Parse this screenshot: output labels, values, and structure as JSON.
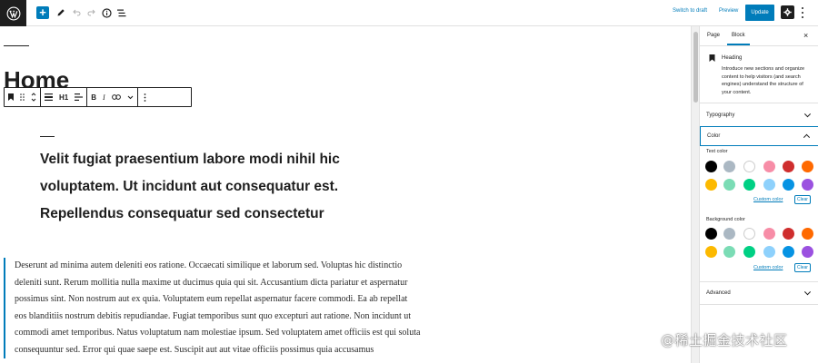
{
  "top_toolbar": {
    "switch_to_draft": "Switch to draft",
    "preview": "Preview",
    "update": "Update"
  },
  "editor": {
    "page_title": "Home",
    "block_toolbar": {
      "heading_level": "H1"
    },
    "heading": "Velit fugiat praesentium labore modi nihil hic voluptatem. Ut incidunt aut consequatur est. Repellendus consequatur sed consectetur",
    "paragraph": "Deserunt ad minima autem deleniti eos ratione. Occaecati similique et laborum sed. Voluptas hic distinctio deleniti sunt. Rerum mollitia nulla maxime ut ducimus quia qui sit. Accusantium dicta pariatur et aspernatur possimus sint. Non nostrum aut ex quia. Voluptatem eum repellat aspernatur facere commodi. Ea ab repellat eos blanditiis nostrum debitis repudiandae. Fugiat temporibus sunt quo excepturi aut ratione. Non incidunt ut commodi amet temporibus. Natus voluptatum nam molestiae ipsum. Sed voluptatem amet officiis est qui soluta consequuntur sed. Error qui quae saepe est. Suscipit aut aut vitae officiis possimus quia accusamus"
  },
  "sidebar": {
    "tabs": [
      "Page",
      "Block"
    ],
    "active_tab": "Block",
    "block_card": {
      "title": "Heading",
      "description": "Introduce new sections and organize content to help visitors (and search engines) understand the structure of your content."
    },
    "panels": {
      "typography": "Typography",
      "color": "Color",
      "advanced": "Advanced"
    },
    "text_color_label": "Text color",
    "background_color_label": "Background color",
    "custom_color": "Custom color",
    "clear": "Clear",
    "palette": [
      "#000000",
      "#abb8c3",
      "#ffffff",
      "#f78da7",
      "#cf2e2e",
      "#ff6900",
      "#fcb900",
      "#7bdcb5",
      "#00d084",
      "#8ed1fc",
      "#0693e3",
      "#9b51e0"
    ]
  },
  "colors": {
    "accent": "#007cba",
    "dark": "#1e1e1e"
  },
  "watermark": "@稀土掘金技术社区"
}
